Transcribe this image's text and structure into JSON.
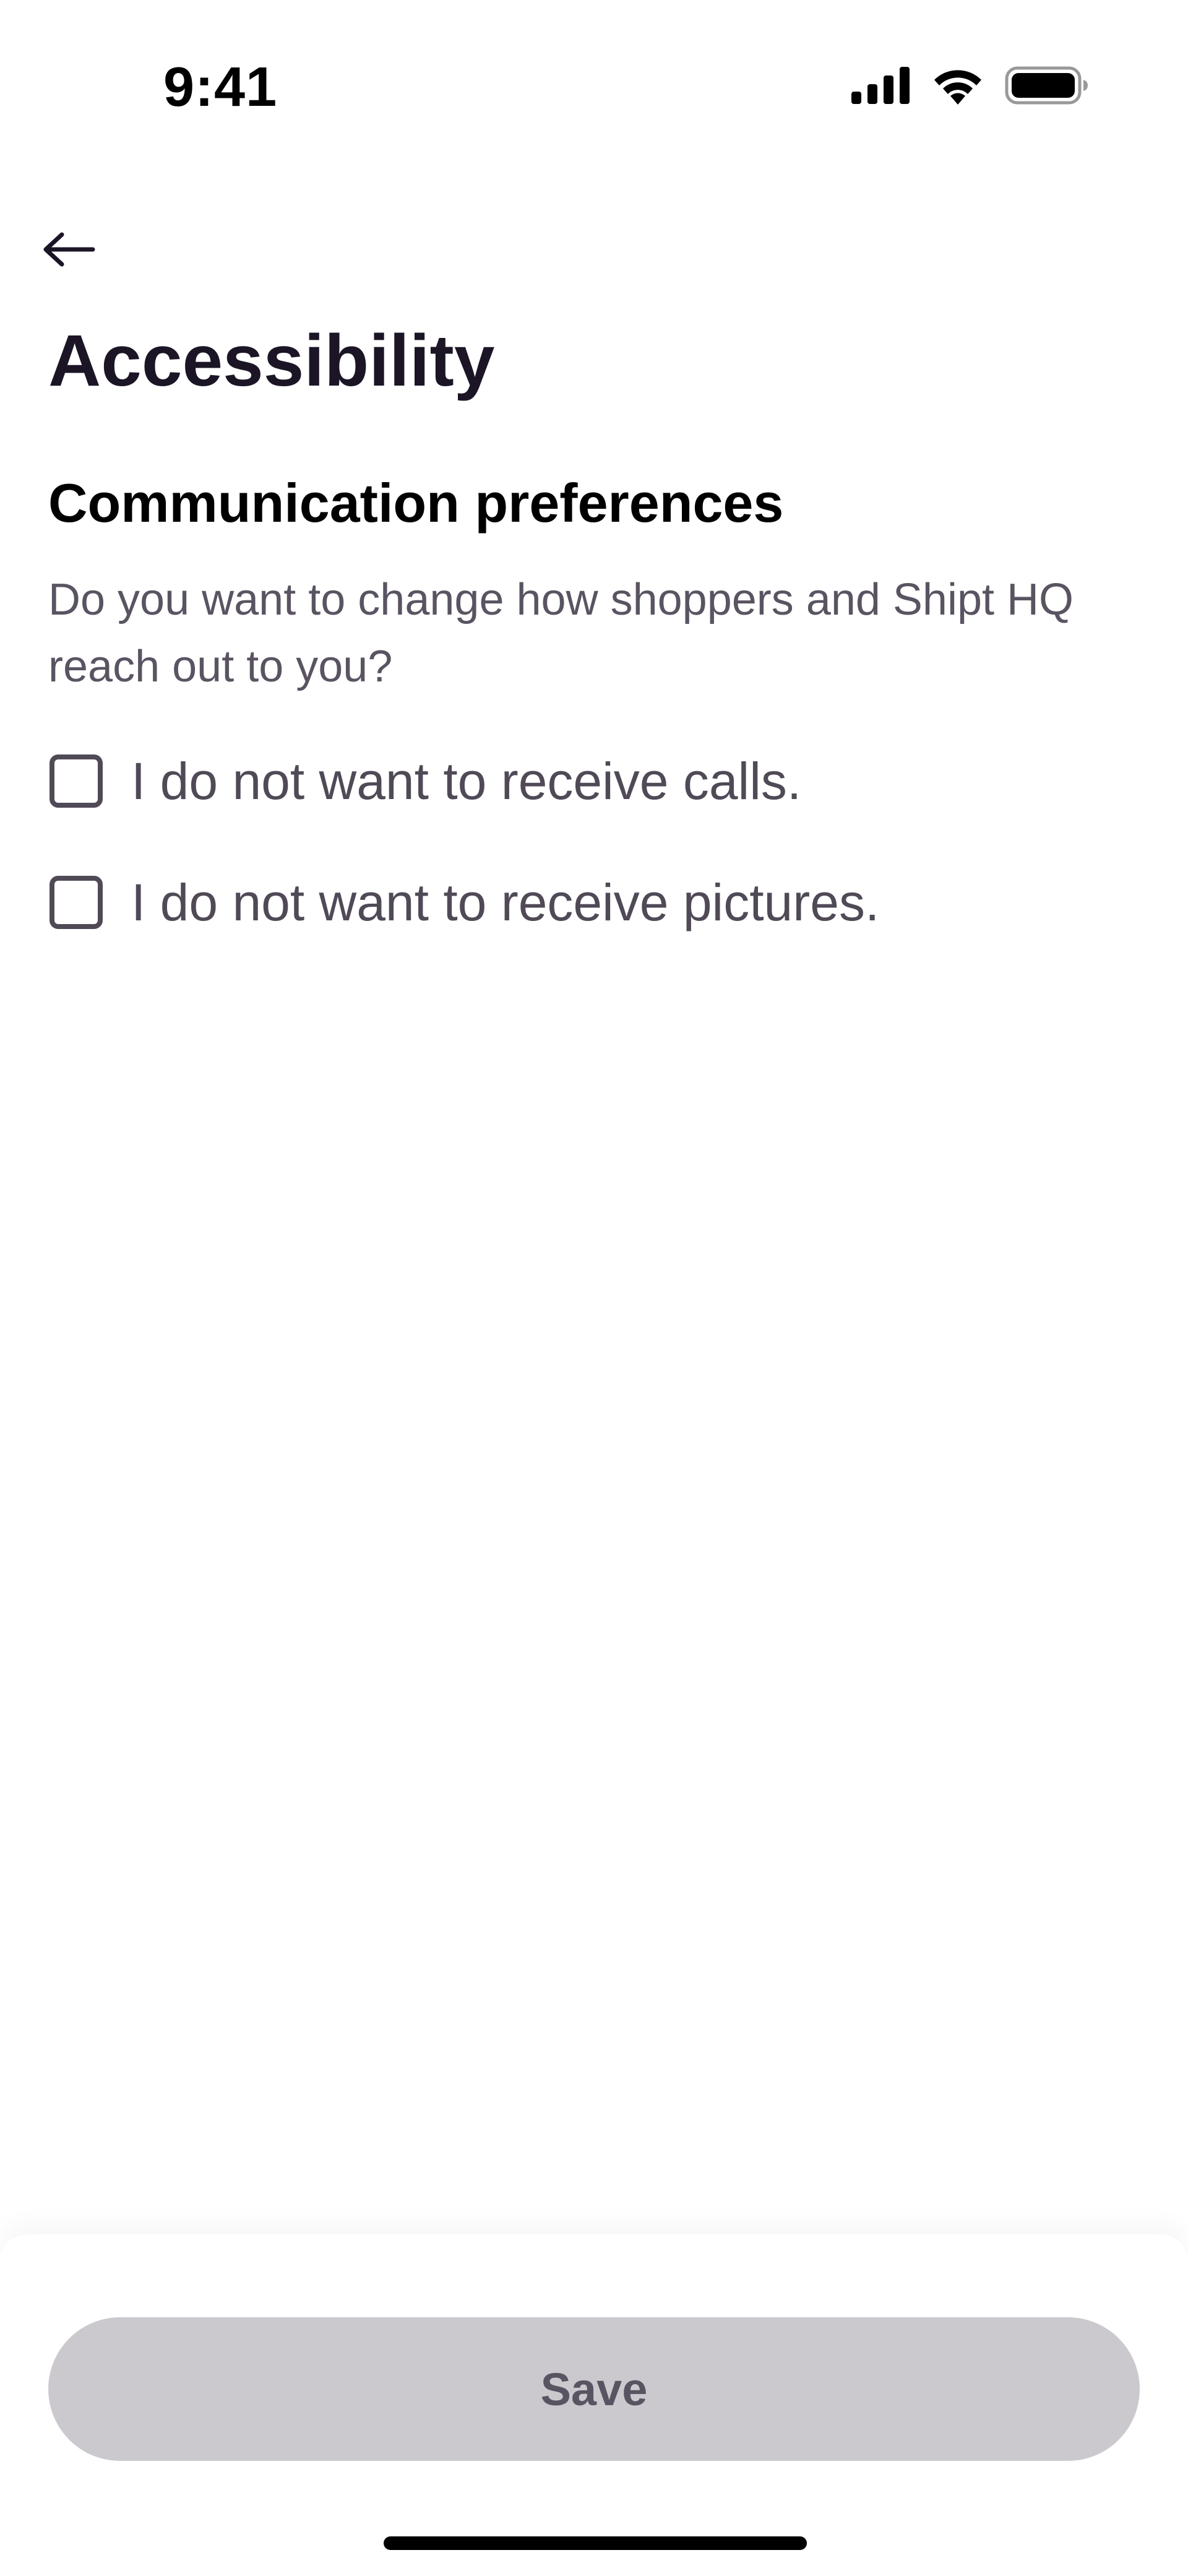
{
  "status_bar": {
    "time": "9:41",
    "icons": [
      "cellular-signal-icon",
      "wifi-icon",
      "battery-icon"
    ]
  },
  "header": {
    "back_icon": "arrow-left-icon",
    "title": "Accessibility"
  },
  "communication_preferences": {
    "title": "Communication preferences",
    "description": "Do you want to change how shoppers and Shipt HQ reach out to you?",
    "options": [
      {
        "label": "I do not want to receive calls.",
        "checked": false
      },
      {
        "label": "I do not want to receive pictures.",
        "checked": false
      }
    ]
  },
  "footer": {
    "save_label": "Save",
    "save_enabled": false
  },
  "colors": {
    "title": "#1c1526",
    "body_text": "#5a5462",
    "checkbox_border": "#504a57",
    "button_disabled_bg": "#cbc9ce"
  }
}
